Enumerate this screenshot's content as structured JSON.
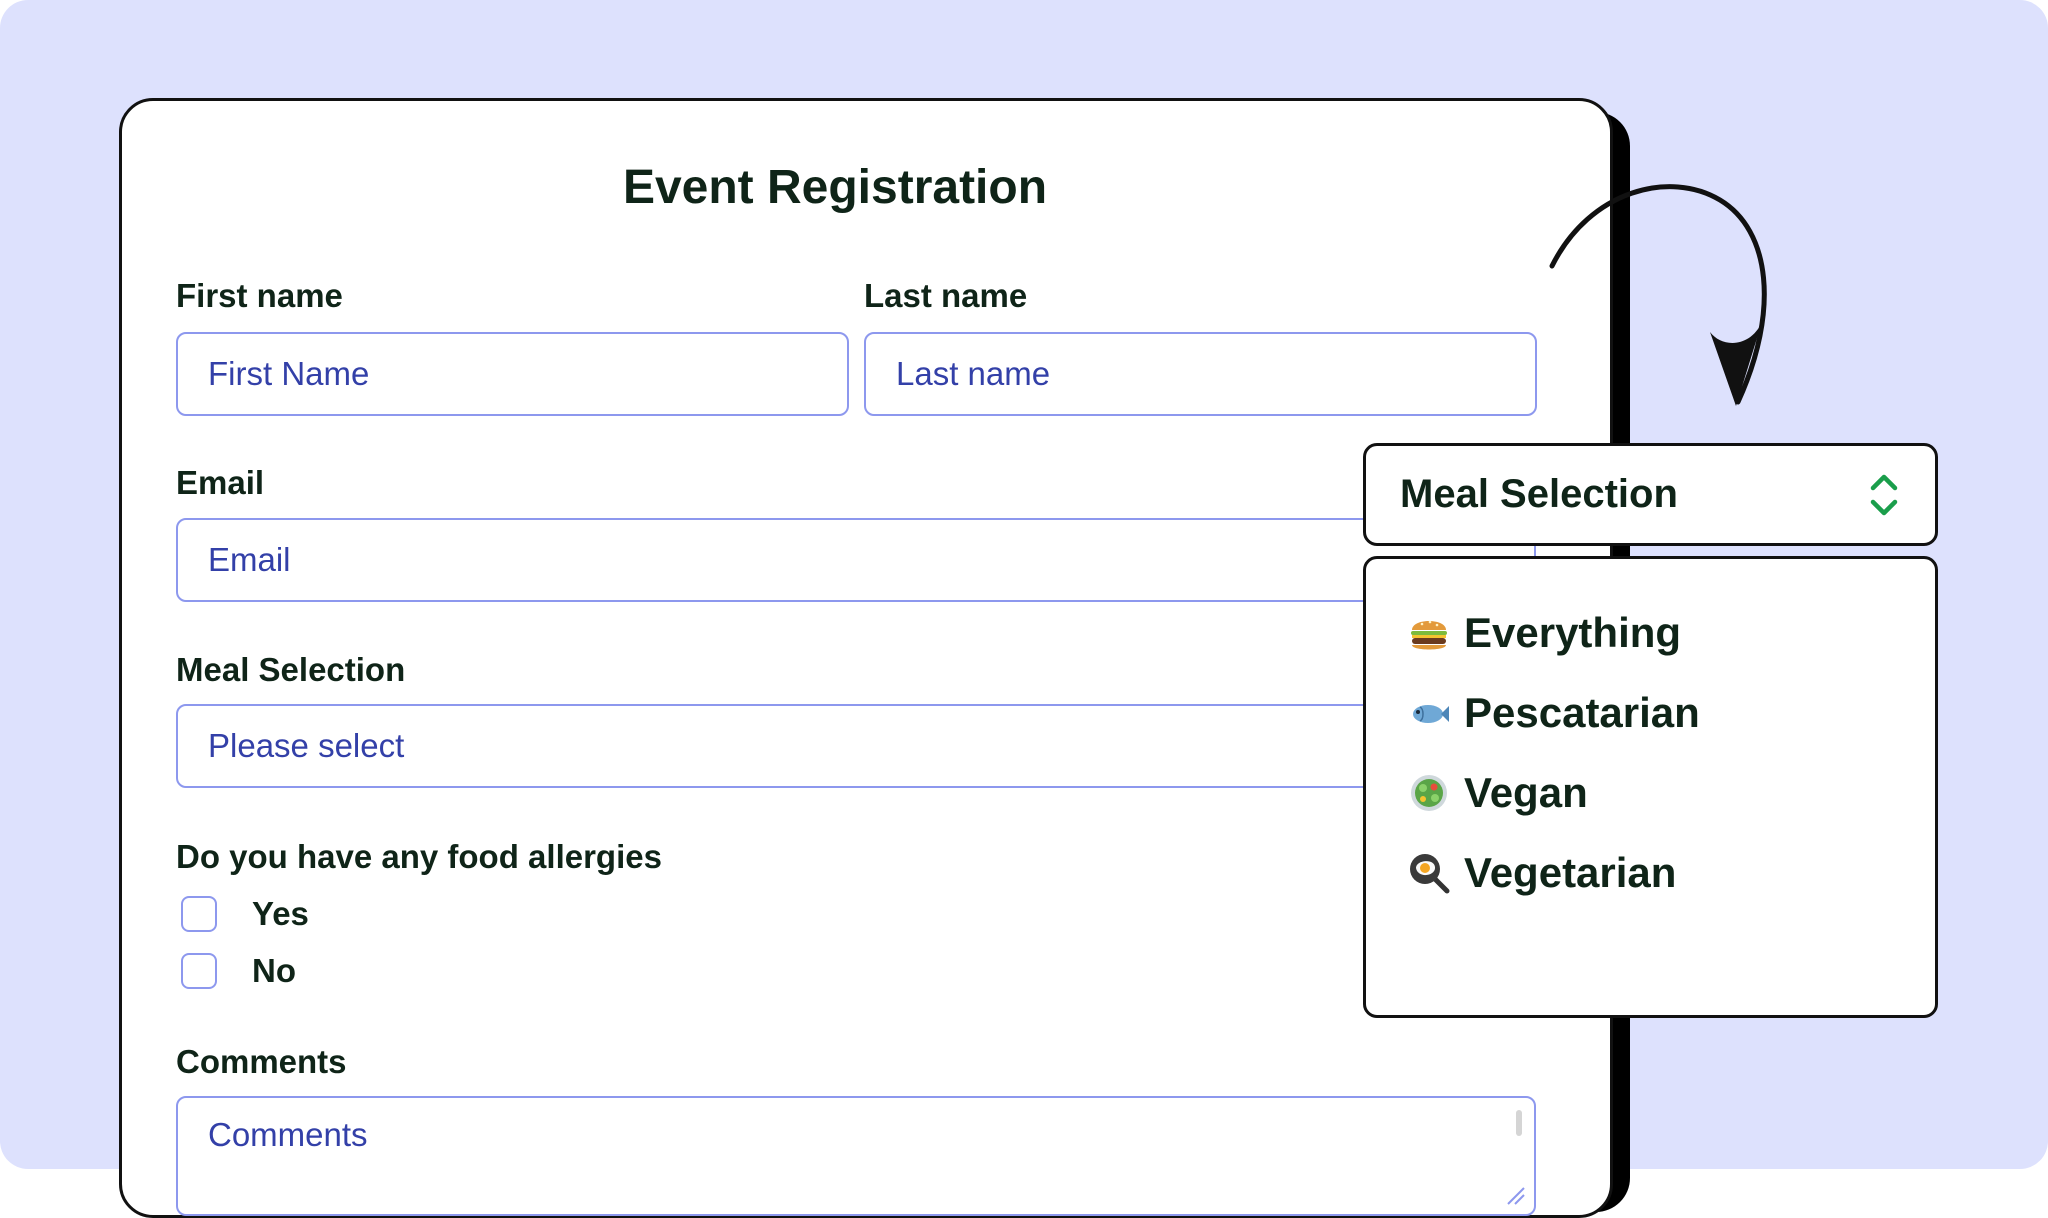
{
  "form": {
    "title": "Event Registration",
    "first_name_label": "First name",
    "first_name_placeholder": "First Name",
    "last_name_label": "Last name",
    "last_name_placeholder": "Last name",
    "email_label": "Email",
    "email_placeholder": "Email",
    "meal_label": "Meal Selection",
    "meal_placeholder": "Please select",
    "allergies_label": "Do you have any food allergies",
    "allergy_options": [
      "Yes",
      "No"
    ],
    "comments_label": "Comments",
    "comments_placeholder": "Comments"
  },
  "dropdown": {
    "label": "Meal Selection",
    "options": [
      {
        "icon": "burger-icon",
        "label": "Everything"
      },
      {
        "icon": "fish-icon",
        "label": "Pescatarian"
      },
      {
        "icon": "salad-icon",
        "label": "Vegan"
      },
      {
        "icon": "fried-egg-icon",
        "label": "Vegetarian"
      }
    ]
  },
  "colors": {
    "background": "#dde1fd",
    "field_border": "#8d98ee",
    "placeholder_text": "#3340a8",
    "heading_text": "#0f2418",
    "chevron_accent": "#1a9e4b"
  }
}
